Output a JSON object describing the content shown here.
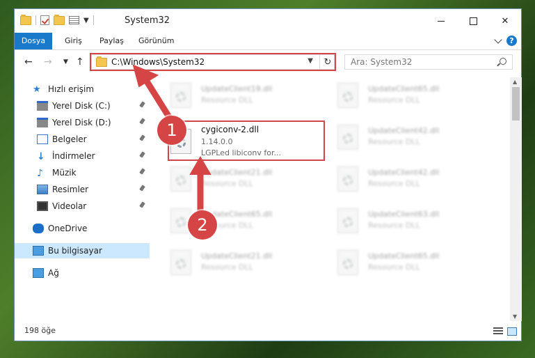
{
  "window": {
    "title": "System32",
    "controls": {
      "minimize": "",
      "maximize": "",
      "close": "✕"
    }
  },
  "ribbon": {
    "tabs": [
      "Dosya",
      "Giriş",
      "Paylaş",
      "Görünüm"
    ],
    "help": "?"
  },
  "navigation": {
    "address": "C:\\Windows\\System32",
    "search_placeholder": "Ara: System32"
  },
  "sidebar": {
    "items": [
      {
        "label": "Hızlı erişim",
        "icon": "star-icon"
      },
      {
        "label": "Yerel Disk (C:)",
        "icon": "drive-icon",
        "pinned": true
      },
      {
        "label": "Yerel Disk (D:)",
        "icon": "drive-icon",
        "pinned": true
      },
      {
        "label": "Belgeler",
        "icon": "documents-icon",
        "pinned": true
      },
      {
        "label": "İndirmeler",
        "icon": "downloads-icon",
        "pinned": true
      },
      {
        "label": "Müzik",
        "icon": "music-icon",
        "pinned": true
      },
      {
        "label": "Resimler",
        "icon": "pictures-icon",
        "pinned": true
      },
      {
        "label": "Videolar",
        "icon": "videos-icon",
        "pinned": true
      },
      {
        "label": "OneDrive",
        "icon": "onedrive-icon"
      },
      {
        "label": "Bu bilgisayar",
        "icon": "this-pc-icon",
        "selected": true
      },
      {
        "label": "Ağ",
        "icon": "network-icon"
      }
    ]
  },
  "files": {
    "focused": {
      "name": "cygiconv-2.dll",
      "version": "1.14.0.0",
      "description": "LGPLed libiconv for..."
    },
    "blurred": [
      {
        "name": "UpdateClient19.dll",
        "desc": "Resource DLL"
      },
      {
        "name": "UpdateClient65.dll",
        "desc": "Resource DLL"
      },
      {
        "name": "UpdateClient42.dll",
        "desc": "Resource DLL"
      },
      {
        "name": "UpdateClient21.dll",
        "desc": "Resource DLL"
      },
      {
        "name": "UpdateClient42.dll",
        "desc": "Resource DLL"
      },
      {
        "name": "UpdateClient65.dll",
        "desc": "Resource DLL"
      },
      {
        "name": "UpdateClient63.dll",
        "desc": "Resource DLL"
      },
      {
        "name": "UpdateClient21.dll",
        "desc": "Resource DLL"
      },
      {
        "name": "UpdateClient65.dll",
        "desc": "Resource DLL"
      }
    ]
  },
  "status": {
    "count": "198 öğe"
  },
  "annotations": {
    "step1": "1",
    "step2": "2",
    "color": "#d64545"
  }
}
